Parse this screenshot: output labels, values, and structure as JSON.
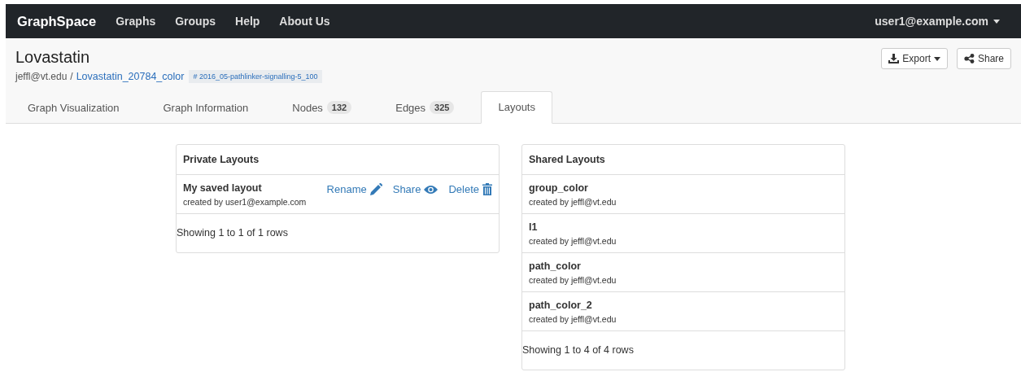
{
  "navbar": {
    "brand": "GraphSpace",
    "links": [
      "Graphs",
      "Groups",
      "Help",
      "About Us"
    ],
    "user": "user1@example.com"
  },
  "graph": {
    "title": "Lovastatin",
    "owner": "jeffl@vt.edu",
    "separator": "/",
    "name": "Lovastatin_20784_color",
    "tag": "# 2016_05-pathlinker-signalling-5_100"
  },
  "actions": [
    {
      "label": "Export",
      "kind": "export"
    },
    {
      "label": "Share",
      "kind": "share"
    }
  ],
  "tabs": [
    {
      "label": "Graph Visualization",
      "selected": false
    },
    {
      "label": "Graph Information",
      "selected": false
    },
    {
      "label": "Nodes",
      "count": "132",
      "selected": false
    },
    {
      "label": "Edges",
      "count": "325",
      "selected": false
    },
    {
      "label": "Layouts",
      "selected": true
    }
  ],
  "panels": [
    {
      "title": "Private Layouts",
      "rows": [
        {
          "name": "My saved layout",
          "creator": "created by user1@example.com",
          "actions": [
            {
              "label": "Rename",
              "kind": "rename"
            },
            {
              "label": "Share",
              "kind": "share"
            },
            {
              "label": "Delete",
              "kind": "delete"
            }
          ]
        }
      ],
      "footer": "Showing 1 to 1 of 1 rows"
    },
    {
      "title": "Shared Layouts",
      "rows": [
        {
          "name": "group_color",
          "creator": "created by jeffl@vt.edu"
        },
        {
          "name": "l1",
          "creator": "created by jeffl@vt.edu"
        },
        {
          "name": "path_color",
          "creator": "created by jeffl@vt.edu"
        },
        {
          "name": "path_color_2",
          "creator": "created by jeffl@vt.edu"
        }
      ],
      "footer": "Showing 1 to 4 of 4 rows"
    }
  ]
}
